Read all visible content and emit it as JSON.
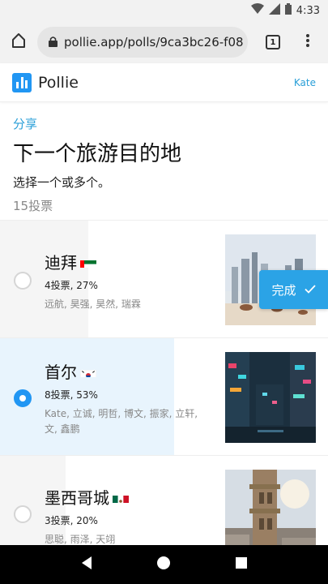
{
  "status_bar": {
    "time": "4:33"
  },
  "browser": {
    "url": "pollie.app/polls/9ca3bc26-f08",
    "tab_count": "1"
  },
  "app": {
    "brand": "Pollie",
    "user": "Kate"
  },
  "poll": {
    "share_label": "分享",
    "title": "下一个旅游目的地",
    "subtitle": "选择一个或多个。",
    "vote_total": "15投票"
  },
  "options": [
    {
      "name": "迪拜",
      "flag": "UAE",
      "stats": "4投票, 27%",
      "voters": "远航, 昊强, 昊然, 瑞霖",
      "percent": 27,
      "selected": false
    },
    {
      "name": "首尔",
      "flag": "Korea",
      "stats": "8投票, 53%",
      "voters": "Kate, 立诚, 明哲, 博文, 振家, 立轩, 文, 鑫鹏",
      "percent": 53,
      "selected": true
    },
    {
      "name": "墨西哥城",
      "flag": "Mexico",
      "stats": "3投票, 20%",
      "voters": "思聪, 雨泽, 天翊",
      "percent": 20,
      "selected": false
    }
  ],
  "done_button": {
    "label": "完成"
  },
  "colors": {
    "accent": "#2196f3",
    "link": "#2a9fd8",
    "done": "#2ba3e6"
  }
}
